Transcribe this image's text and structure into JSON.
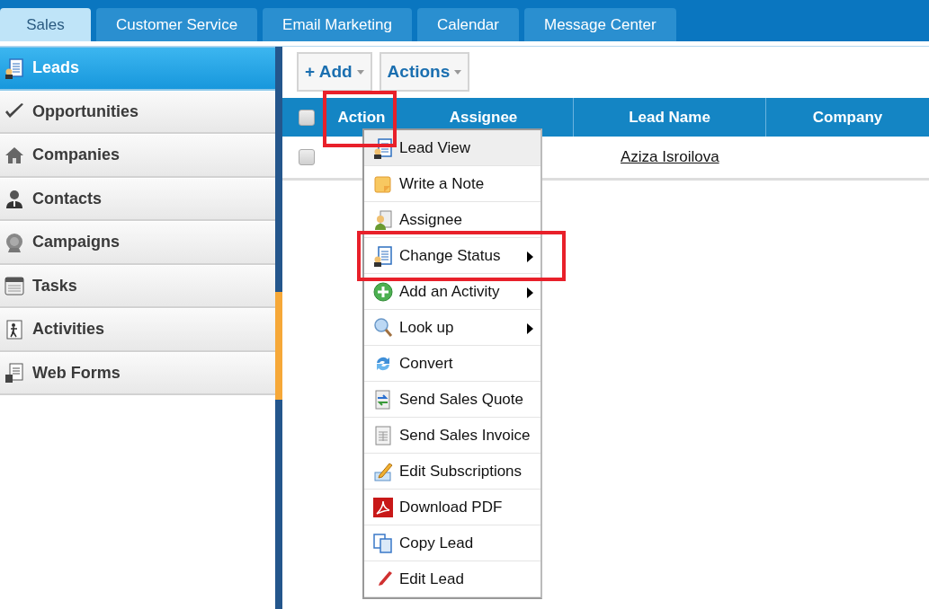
{
  "tabs": [
    {
      "label": "Sales",
      "selected": true
    },
    {
      "label": "Customer Service",
      "selected": false
    },
    {
      "label": "Email Marketing",
      "selected": false
    },
    {
      "label": "Calendar",
      "selected": false
    },
    {
      "label": "Message Center",
      "selected": false
    }
  ],
  "sidebar": {
    "items": [
      {
        "label": "Leads",
        "selected": true
      },
      {
        "label": "Opportunities",
        "selected": false
      },
      {
        "label": "Companies",
        "selected": false
      },
      {
        "label": "Contacts",
        "selected": false
      },
      {
        "label": "Campaigns",
        "selected": false
      },
      {
        "label": "Tasks",
        "selected": false
      },
      {
        "label": "Activities",
        "selected": false
      },
      {
        "label": "Web Forms",
        "selected": false
      }
    ]
  },
  "toolbar": {
    "buttons": [
      "+ Add",
      "Actions"
    ]
  },
  "table": {
    "select_all": {
      "checked": false
    },
    "columns": [
      {
        "label": "Action",
        "highlighted": true
      },
      {
        "label": "Assignee",
        "highlighted": false
      },
      {
        "label": "Lead Name",
        "highlighted": false
      },
      {
        "label": "Company",
        "highlighted": false
      }
    ],
    "rows": [
      {
        "checked": false,
        "lead_name": "Aziza Isroilova"
      }
    ]
  },
  "context_menu": {
    "items": [
      {
        "label": "Lead View",
        "hovered": true,
        "submenu": false,
        "highlighted": false
      },
      {
        "label": "Write a Note",
        "hovered": false,
        "submenu": false,
        "highlighted": false
      },
      {
        "label": "Assignee",
        "hovered": false,
        "submenu": false,
        "highlighted": false
      },
      {
        "label": "Change Status",
        "hovered": false,
        "submenu": true,
        "highlighted": true
      },
      {
        "label": "Add an Activity",
        "hovered": false,
        "submenu": true,
        "highlighted": false
      },
      {
        "label": "Look up",
        "hovered": false,
        "submenu": true,
        "highlighted": false
      },
      {
        "label": "Convert",
        "hovered": false,
        "submenu": false,
        "highlighted": false
      },
      {
        "label": "Send Sales Quote",
        "hovered": false,
        "submenu": false,
        "highlighted": false
      },
      {
        "label": "Send Sales Invoice",
        "hovered": false,
        "submenu": false,
        "highlighted": false
      },
      {
        "label": "Edit Subscriptions",
        "hovered": false,
        "submenu": false,
        "highlighted": false
      },
      {
        "label": "Download PDF",
        "hovered": false,
        "submenu": false,
        "highlighted": false
      },
      {
        "label": "Copy Lead",
        "hovered": false,
        "submenu": false,
        "highlighted": false
      },
      {
        "label": "Edit Lead",
        "hovered": false,
        "submenu": false,
        "highlighted": false
      }
    ]
  }
}
